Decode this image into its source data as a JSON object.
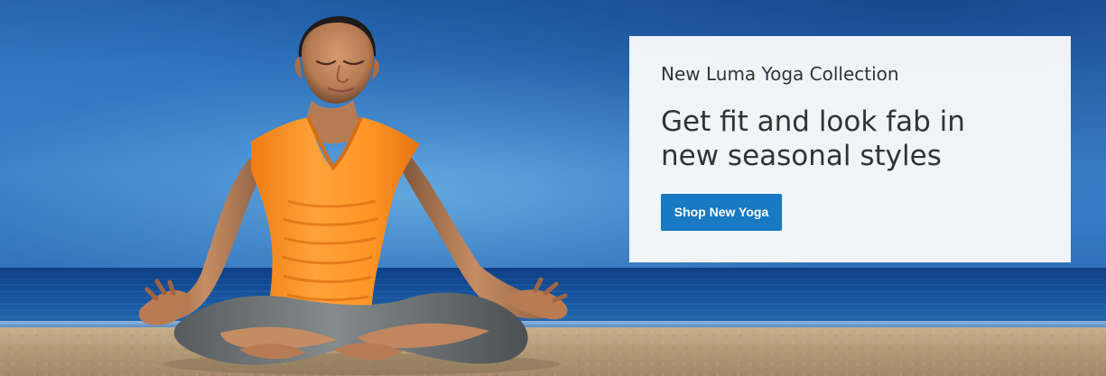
{
  "promo": {
    "eyebrow": "New Luma Yoga Collection",
    "headline": "Get fit and look fab in new seasonal styles",
    "cta_label": "Shop New Yoga"
  },
  "colors": {
    "button": "#1979c3",
    "text": "#333333",
    "card": "#f8fafc",
    "shirt": "#ff9b25",
    "sky": "#3b83cb",
    "sand": "#b39b77"
  }
}
